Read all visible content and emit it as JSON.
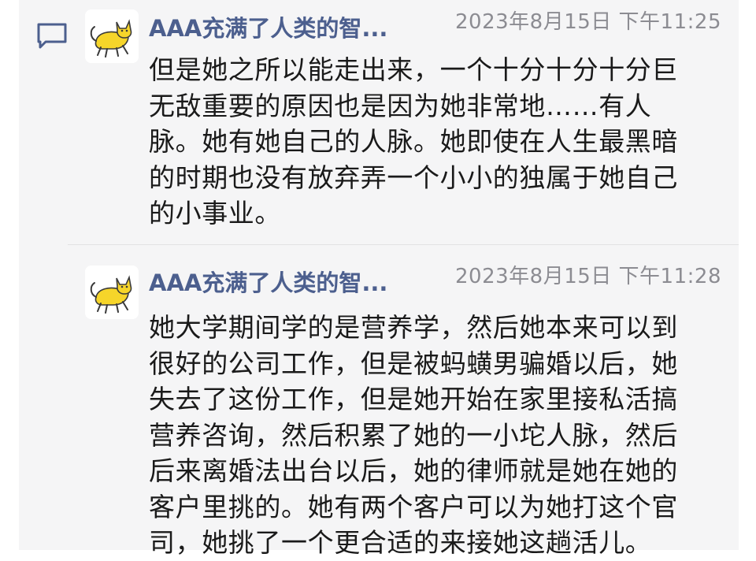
{
  "icons": {
    "comment": "comment-icon",
    "avatar": "yellow-cat-avatar"
  },
  "colors": {
    "author": "#4c5f8e",
    "icon": "#4c5f8e",
    "time": "#8c8c92",
    "text": "#1a1a1a",
    "panel_bg": "#f5f5f6",
    "avatar_cat": "#f6d52a"
  },
  "posts": [
    {
      "author": "AAA充满了人类的智...",
      "time": "2023年8月15日 下午11:25",
      "text": "但是她之所以能走出来，一个十分十分十分巨无敌重要的原因也是因为她非常地……有人脉。她有她自己的人脉。她即使在人生最黑暗的时期也没有放弃弄一个小小的独属于她自己的小事业。"
    },
    {
      "author": "AAA充满了人类的智...",
      "time": "2023年8月15日 下午11:28",
      "text": "她大学期间学的是营养学，然后她本来可以到很好的公司工作，但是被蚂蟥男骗婚以后，她失去了这份工作，但是她开始在家里接私活搞营养咨询，然后积累了她的一小坨人脉，然后后来离婚法出台以后，她的律师就是她在她的客户里挑的。她有两个客户可以为她打这个官司，她挑了一个更合适的来接她这趟活儿。"
    }
  ]
}
